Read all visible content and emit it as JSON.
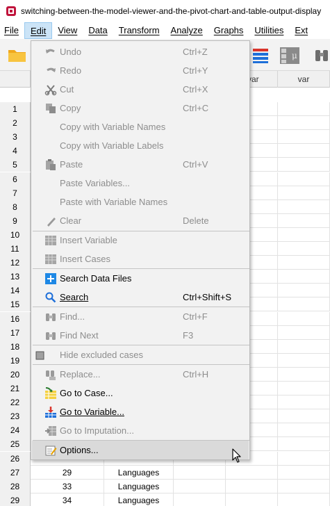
{
  "window": {
    "title": "switching-between-the-model-viewer-and-the-pivot-chart-and-table-output-display"
  },
  "menubar": {
    "items": [
      "File",
      "Edit",
      "View",
      "Data",
      "Transform",
      "Analyze",
      "Graphs",
      "Utilities",
      "Ext"
    ],
    "active": "Edit"
  },
  "grid": {
    "headers": [
      "var",
      "var"
    ],
    "row_numbers": [
      "1",
      "2",
      "3",
      "4",
      "5",
      "6",
      "7",
      "8",
      "9",
      "10",
      "11",
      "12",
      "13",
      "14",
      "15",
      "16",
      "17",
      "18",
      "19",
      "20",
      "21",
      "22",
      "23",
      "24",
      "25",
      "26",
      "27",
      "28",
      "29"
    ],
    "visible_rows": [
      {
        "row": "27",
        "id": "29",
        "subject": "Languages"
      },
      {
        "row": "28",
        "id": "33",
        "subject": "Languages"
      },
      {
        "row": "29",
        "id": "34",
        "subject": "Languages"
      }
    ]
  },
  "edit_menu": {
    "items": [
      {
        "label": "Undo",
        "shortcut": "Ctrl+Z",
        "enabled": false,
        "icon": "undo-icon"
      },
      {
        "label": "Redo",
        "shortcut": "Ctrl+Y",
        "enabled": false,
        "icon": "redo-icon"
      },
      {
        "label": "Cut",
        "shortcut": "Ctrl+X",
        "enabled": false,
        "icon": "scissors-icon"
      },
      {
        "label": "Copy",
        "shortcut": "Ctrl+C",
        "enabled": false,
        "icon": "copy-icon"
      },
      {
        "label": "Copy with Variable Names",
        "shortcut": "",
        "enabled": false,
        "icon": ""
      },
      {
        "label": "Copy with Variable Labels",
        "shortcut": "",
        "enabled": false,
        "icon": ""
      },
      {
        "label": "Paste",
        "shortcut": "Ctrl+V",
        "enabled": false,
        "icon": "paste-icon"
      },
      {
        "label": "Paste Variables...",
        "shortcut": "",
        "enabled": false,
        "icon": ""
      },
      {
        "label": "Paste with Variable Names",
        "shortcut": "",
        "enabled": false,
        "icon": ""
      },
      {
        "label": "Clear",
        "shortcut": "Delete",
        "enabled": false,
        "icon": "eraser-icon"
      },
      {
        "label": "Insert Variable",
        "shortcut": "",
        "enabled": false,
        "icon": "insert-variable-icon"
      },
      {
        "label": "Insert Cases",
        "shortcut": "",
        "enabled": false,
        "icon": "insert-cases-icon"
      },
      {
        "label": "Search Data Files",
        "shortcut": "",
        "enabled": true,
        "icon": "plus-icon"
      },
      {
        "label": "Search",
        "shortcut": "Ctrl+Shift+S",
        "enabled": true,
        "icon": "search-icon"
      },
      {
        "label": "Find...",
        "shortcut": "Ctrl+F",
        "enabled": false,
        "icon": "binoculars-icon"
      },
      {
        "label": "Find Next",
        "shortcut": "F3",
        "enabled": false,
        "icon": "binoculars-next-icon"
      },
      {
        "label": "Hide excluded cases",
        "shortcut": "",
        "enabled": false,
        "icon": "checkbox-icon"
      },
      {
        "label": "Replace...",
        "shortcut": "Ctrl+H",
        "enabled": false,
        "icon": "replace-icon"
      },
      {
        "label": "Go to Case...",
        "shortcut": "",
        "enabled": true,
        "icon": "go-to-case-icon"
      },
      {
        "label": "Go to Variable...",
        "shortcut": "",
        "enabled": true,
        "icon": "go-to-variable-icon"
      },
      {
        "label": "Go to Imputation...",
        "shortcut": "",
        "enabled": false,
        "icon": "go-to-imputation-icon"
      },
      {
        "label": "Options...",
        "shortcut": "",
        "enabled": true,
        "icon": "options-icon"
      }
    ]
  },
  "colors": {
    "menu_active_bg": "#cce4f7",
    "disabled_text": "#8d8d8d",
    "hover_bg": "#dadada"
  }
}
